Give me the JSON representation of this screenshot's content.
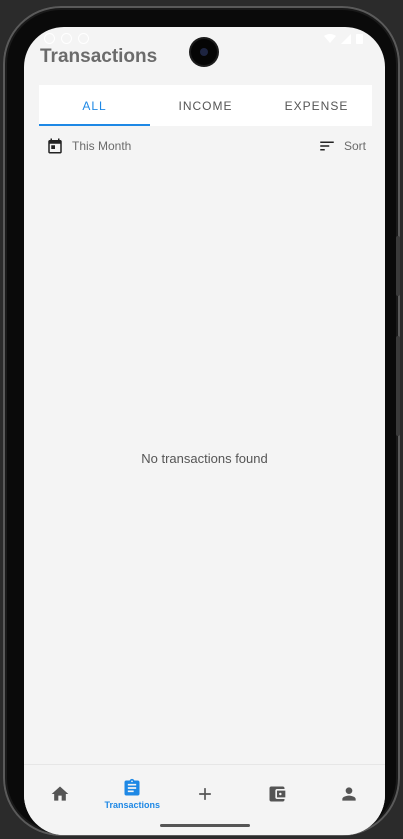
{
  "header": {
    "title": "Transactions"
  },
  "tabs": [
    {
      "label": "ALL",
      "active": true
    },
    {
      "label": "INCOME",
      "active": false
    },
    {
      "label": "EXPENSE",
      "active": false
    }
  ],
  "filters": {
    "period_label": "This Month",
    "period_icon": "calendar-icon",
    "sort_label": "Sort",
    "sort_icon": "sort-icon"
  },
  "empty_state": {
    "message": "No transactions found"
  },
  "bottom_nav": {
    "items": [
      {
        "icon": "home-icon",
        "label": "",
        "active": false
      },
      {
        "icon": "clipboard-icon",
        "label": "Transactions",
        "active": true
      },
      {
        "icon": "plus-icon",
        "label": "",
        "active": false
      },
      {
        "icon": "wallet-icon",
        "label": "",
        "active": false
      },
      {
        "icon": "person-icon",
        "label": "",
        "active": false
      }
    ]
  },
  "colors": {
    "accent": "#1e88e5",
    "background": "#f4f4f4",
    "text_muted": "#6b6b6b",
    "icon": "#555555"
  }
}
